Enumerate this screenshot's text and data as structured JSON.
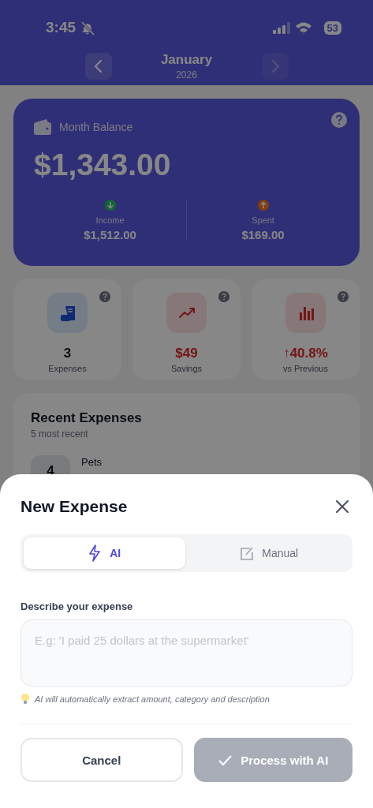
{
  "status_bar": {
    "time": "3:45",
    "battery": "53"
  },
  "header": {
    "month": "January",
    "year": "2026"
  },
  "balance": {
    "title": "Month Balance",
    "amount": "$1,343.00",
    "income": {
      "label": "Income",
      "value": "$1,512.00"
    },
    "spent": {
      "label": "Spent",
      "value": "$169.00"
    }
  },
  "stats": [
    {
      "kind": "expenses",
      "value": "3",
      "label": "Expenses"
    },
    {
      "kind": "savings",
      "value": "$49",
      "label": "Savings"
    },
    {
      "kind": "change",
      "value": "↑40.8%",
      "label": "vs Previous"
    }
  ],
  "recent": {
    "title": "Recent Expenses",
    "subtitle": "5 most recent",
    "items": [
      {
        "badge": "4",
        "name": "Pets"
      }
    ]
  },
  "sheet": {
    "title": "New Expense",
    "tabs": [
      {
        "label": "AI",
        "kind": "ai",
        "selected": true
      },
      {
        "label": "Manual",
        "kind": "manual",
        "selected": false
      }
    ],
    "field_label": "Describe your expense",
    "placeholder": "E.g: 'I paid 25 dollars at the supermarket'",
    "hint": "AI will automatically extract amount, category and description",
    "buttons": [
      {
        "label": "Cancel",
        "kind": "cancel",
        "disabled": false
      },
      {
        "label": "Process with AI",
        "kind": "process",
        "disabled": true
      }
    ]
  }
}
